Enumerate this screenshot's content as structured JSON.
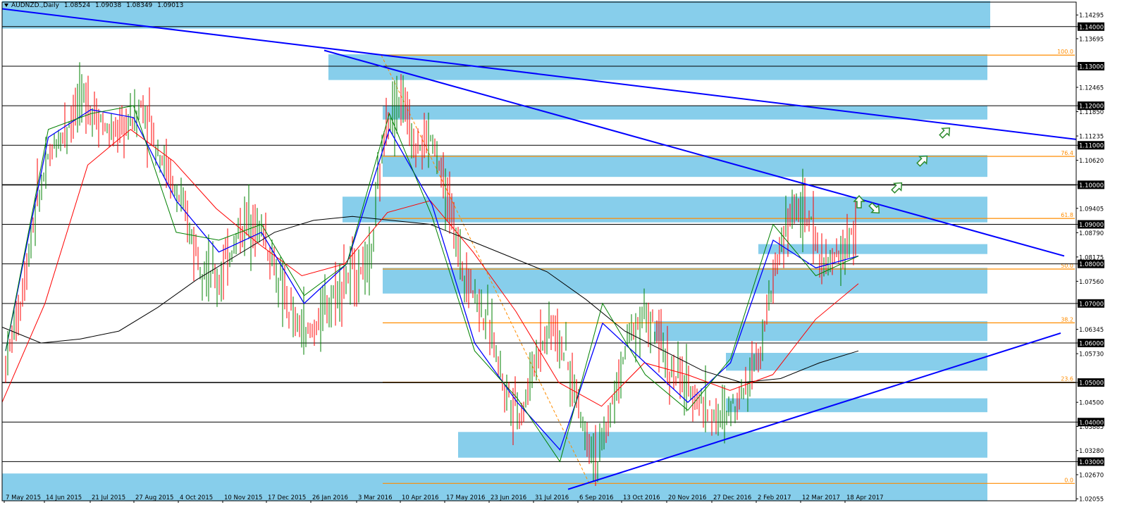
{
  "header": {
    "symbol": "AUDNZD.,Daily",
    "open": "1.08524",
    "high": "1.09038",
    "low": "1.08349",
    "close": "1.09013"
  },
  "colors": {
    "zone": "#87CEEB",
    "trendline": "#0000FF",
    "fib": "#FF8C00",
    "ma_red": "#FF0000",
    "ma_blue": "#0000FF",
    "ma_green": "#008000",
    "ma_black": "#000000",
    "candle": "#008000",
    "arrow": "#2E8B2E",
    "label_bg": "#000000",
    "label_fg": "#FFFFFF"
  },
  "icons": [
    "arrow-up-right-icon",
    "arrow-up-icon",
    "arrow-down-right-icon"
  ],
  "chart_data": {
    "type": "candlestick",
    "title": "AUDNZD.,Daily",
    "ylim": [
      1.0201,
      1.1462
    ],
    "x_axis_labels": [
      "7 May 2015",
      "14 Jun 2015",
      "21 Jul 2015",
      "27 Aug 2015",
      "4 Oct 2015",
      "10 Nov 2015",
      "17 Dec 2015",
      "26 Jan 2016",
      "3 Mar 2016",
      "10 Apr 2016",
      "17 May 2016",
      "23 Jun 2016",
      "31 Jul 2016",
      "6 Sep 2016",
      "13 Oct 2016",
      "20 Nov 2016",
      "27 Dec 2016",
      "2 Feb 2017",
      "12 Mar 2017",
      "18 Apr 2017"
    ],
    "y_axis_labels": [
      {
        "v": 1.14295,
        "t": "1.14295"
      },
      {
        "v": 1.14,
        "t": "1.14000"
      },
      {
        "v": 1.13695,
        "t": "1.13695"
      },
      {
        "v": 1.13,
        "t": "1.13000"
      },
      {
        "v": 1.12465,
        "t": "1.12465"
      },
      {
        "v": 1.12,
        "t": "1.12000"
      },
      {
        "v": 1.1185,
        "t": "1.11850"
      },
      {
        "v": 1.11235,
        "t": "1.11235"
      },
      {
        "v": 1.11,
        "t": "1.11000"
      },
      {
        "v": 1.1062,
        "t": "1.10620"
      },
      {
        "v": 1.1,
        "t": "1.10000"
      },
      {
        "v": 1.09405,
        "t": "1.09405"
      },
      {
        "v": 1.09,
        "t": "1.09000"
      },
      {
        "v": 1.0879,
        "t": "1.08790"
      },
      {
        "v": 1.08175,
        "t": "1.08175"
      },
      {
        "v": 1.08,
        "t": "1.08000"
      },
      {
        "v": 1.0756,
        "t": "1.07560"
      },
      {
        "v": 1.07,
        "t": "1.07000"
      },
      {
        "v": 1.06345,
        "t": "1.06345"
      },
      {
        "v": 1.06,
        "t": "1.06000"
      },
      {
        "v": 1.0573,
        "t": "1.05730"
      },
      {
        "v": 1.05,
        "t": "1.05000"
      },
      {
        "v": 1.045,
        "t": "1.04500"
      },
      {
        "v": 1.04,
        "t": "1.04000"
      },
      {
        "v": 1.0389,
        "t": "1.03885"
      },
      {
        "v": 1.0328,
        "t": "1.03280"
      },
      {
        "v": 1.03,
        "t": "1.03000"
      },
      {
        "v": 1.0267,
        "t": "1.02670"
      },
      {
        "v": 1.0206,
        "t": "1.02055"
      }
    ],
    "price_lines": [
      1.14,
      1.13,
      1.12,
      1.11,
      1.1,
      1.09,
      1.08,
      1.07,
      1.06,
      1.05,
      1.04,
      1.03
    ],
    "highlighted_price_labels": [
      "1.14000",
      "1.13000",
      "1.12000",
      "1.11000",
      "1.10000",
      "1.09000",
      "1.08000",
      "1.07000",
      "1.06000",
      "1.05000",
      "1.04000",
      "1.03000"
    ],
    "fibonacci": {
      "from": {
        "date": "3 Mar 2016",
        "price": 1.1328
      },
      "to": {
        "date": "6 Sep 2016",
        "price": 1.0245
      },
      "levels": [
        {
          "label": "100.0",
          "price": 1.1328
        },
        {
          "label": "76.4",
          "price": 1.1072
        },
        {
          "label": "61.8",
          "price": 1.0915
        },
        {
          "label": "50.0",
          "price": 1.0787
        },
        {
          "label": "38.2",
          "price": 1.0651
        },
        {
          "label": "23.6",
          "price": 1.0501
        },
        {
          "label": "0.0",
          "price": 1.0245
        }
      ]
    },
    "zones": [
      {
        "from": "7 May 2015",
        "to": "end",
        "low": 1.1395,
        "high": 1.1465
      },
      {
        "from": "3 Mar 2016",
        "to": "end",
        "low": 1.1265,
        "high": 1.133
      },
      {
        "from": "10 Apr 2016",
        "to": "end",
        "low": 1.1165,
        "high": 1.12
      },
      {
        "from": "10 Apr 2016",
        "to": "end",
        "low": 1.102,
        "high": 1.1075
      },
      {
        "from": "26 Jan 2016",
        "to": "end",
        "low": 1.0905,
        "high": 1.097
      },
      {
        "from": "2 Feb 2017",
        "to": "end",
        "low": 1.0825,
        "high": 1.085
      },
      {
        "from": "10 Apr 2016",
        "to": "end",
        "low": 1.0725,
        "high": 1.079
      },
      {
        "from": "13 Oct 2016",
        "to": "end",
        "low": 1.0605,
        "high": 1.0655
      },
      {
        "from": "27 Dec 2016",
        "to": "end",
        "low": 1.053,
        "high": 1.0575
      },
      {
        "from": "27 Dec 2016",
        "to": "end",
        "low": 1.0425,
        "high": 1.046
      },
      {
        "from": "23 Jun 2016",
        "to": "end",
        "low": 1.031,
        "high": 1.0375
      },
      {
        "from": "7 May 2015",
        "to": "end",
        "low": 1.02,
        "high": 1.027
      }
    ],
    "trendlines": [
      {
        "name": "",
        "points": [
          {
            "date": "7 May 2015",
            "price": 1.1445
          },
          {
            "date": "end",
            "price": 1.1115
          }
        ]
      },
      {
        "name": "",
        "points": [
          {
            "date": "26 Jan 2016",
            "price": 1.134
          },
          {
            "date": "end",
            "price": 1.082
          }
        ]
      },
      {
        "name": "",
        "points": [
          {
            "date": "6 Sep 2016",
            "price": 1.023
          },
          {
            "date": "end",
            "price": 1.0625
          }
        ]
      }
    ],
    "series": [
      {
        "kind": "ma_black",
        "values": [
          1.064,
          1.06,
          1.061,
          1.063,
          1.069,
          1.076,
          1.082,
          1.088,
          1.091,
          1.092,
          1.091,
          1.09,
          1.086,
          1.082,
          1.078,
          1.071,
          1.063,
          1.058,
          1.053,
          1.05,
          1.051,
          1.055,
          1.058
        ]
      },
      {
        "kind": "ma_red",
        "values": [
          1.045,
          1.07,
          1.105,
          1.114,
          1.106,
          1.094,
          1.085,
          1.077,
          1.08,
          1.093,
          1.096,
          1.083,
          1.068,
          1.05,
          1.044,
          1.055,
          1.052,
          1.048,
          1.052,
          1.066,
          1.075
        ]
      },
      {
        "kind": "ma_blue",
        "values": [
          1.058,
          1.112,
          1.119,
          1.117,
          1.096,
          1.083,
          1.088,
          1.07,
          1.08,
          1.114,
          1.095,
          1.06,
          1.045,
          1.033,
          1.065,
          1.055,
          1.045,
          1.055,
          1.086,
          1.079,
          1.082
        ]
      },
      {
        "kind": "ma_green",
        "values": [
          1.058,
          1.114,
          1.118,
          1.12,
          1.088,
          1.086,
          1.09,
          1.072,
          1.08,
          1.118,
          1.092,
          1.058,
          1.046,
          1.03,
          1.07,
          1.052,
          1.043,
          1.056,
          1.09,
          1.077,
          1.082
        ]
      }
    ],
    "candle_closes": [
      1.055,
      1.07,
      1.095,
      1.108,
      1.115,
      1.122,
      1.118,
      1.112,
      1.115,
      1.12,
      1.11,
      1.1,
      1.09,
      1.08,
      1.075,
      1.085,
      1.092,
      1.088,
      1.075,
      1.065,
      1.062,
      1.068,
      1.075,
      1.078,
      1.08,
      1.115,
      1.122,
      1.11,
      1.112,
      1.098,
      1.08,
      1.072,
      1.062,
      1.048,
      1.042,
      1.058,
      1.065,
      1.055,
      1.04,
      1.03,
      1.045,
      1.062,
      1.068,
      1.06,
      1.052,
      1.048,
      1.045,
      1.04,
      1.045,
      1.052,
      1.065,
      1.085,
      1.095,
      1.09,
      1.078,
      1.083,
      1.088
    ]
  }
}
